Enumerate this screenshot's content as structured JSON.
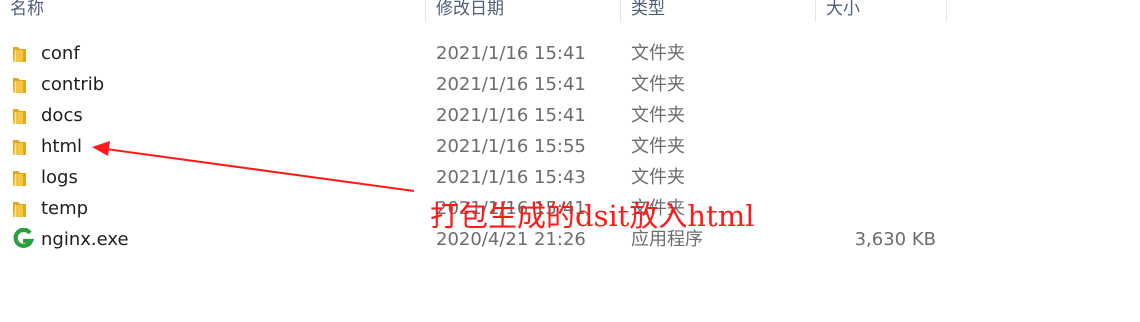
{
  "columns": {
    "name": "名称",
    "modified": "修改日期",
    "type": "类型",
    "size": "大小"
  },
  "files": [
    {
      "name": "conf",
      "modified": "2021/1/16 15:41",
      "type": "文件夹",
      "size": "",
      "icon": "folder-icon"
    },
    {
      "name": "contrib",
      "modified": "2021/1/16 15:41",
      "type": "文件夹",
      "size": "",
      "icon": "folder-icon"
    },
    {
      "name": "docs",
      "modified": "2021/1/16 15:41",
      "type": "文件夹",
      "size": "",
      "icon": "folder-icon"
    },
    {
      "name": "html",
      "modified": "2021/1/16 15:55",
      "type": "文件夹",
      "size": "",
      "icon": "folder-icon"
    },
    {
      "name": "logs",
      "modified": "2021/1/16 15:43",
      "type": "文件夹",
      "size": "",
      "icon": "folder-icon"
    },
    {
      "name": "temp",
      "modified": "2021/1/16 15:41",
      "type": "文件夹",
      "size": "",
      "icon": "folder-icon"
    },
    {
      "name": "nginx.exe",
      "modified": "2020/4/21 21:26",
      "type": "应用程序",
      "size": "3,630 KB",
      "icon": "nginx-app-icon"
    }
  ],
  "annotation": {
    "text": "打包生成的dsit放入html",
    "color": "#ff1a1a"
  },
  "colors": {
    "folder": "#f5c542",
    "folder_dark": "#e0a81e",
    "nginx": "#2e9e3e",
    "header_text": "#4c607a",
    "meta_text": "#6d6d6d"
  }
}
